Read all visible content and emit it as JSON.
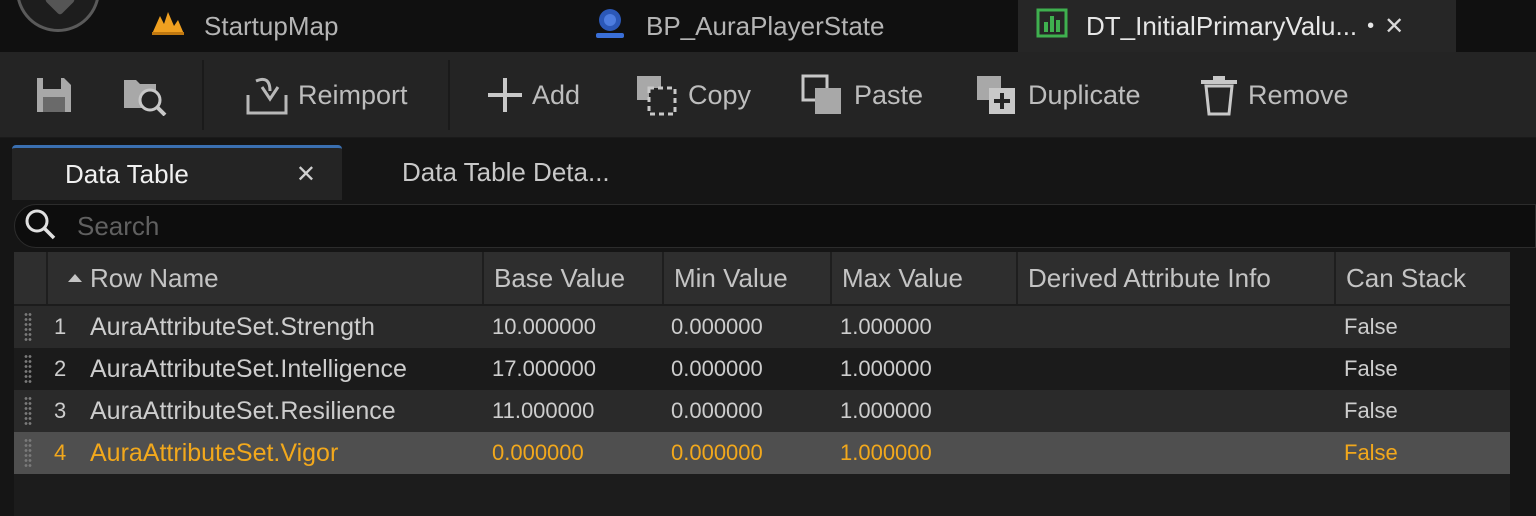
{
  "document_tabs": [
    {
      "label": "StartupMap",
      "icon": "level-map-icon",
      "icon_color": "#f0a020"
    },
    {
      "label": "BP_AuraPlayerState",
      "icon": "blueprint-icon",
      "icon_color": "#3a6fd8"
    },
    {
      "label": "DT_InitialPrimaryValu...",
      "icon": "data-table-icon",
      "icon_color": "#3fb04f",
      "active": true,
      "dirty_mark": "•",
      "close": "✕"
    }
  ],
  "toolbar": {
    "save_icon": "save-icon",
    "browse_icon": "browse-icon",
    "reimport": "Reimport",
    "add": "Add",
    "copy": "Copy",
    "paste": "Paste",
    "duplicate": "Duplicate",
    "remove": "Remove"
  },
  "panel_tabs": [
    {
      "label": "Data Table",
      "close": "✕",
      "active": true
    },
    {
      "label": "Data Table Deta..."
    }
  ],
  "search": {
    "placeholder": "Search",
    "value": ""
  },
  "table": {
    "columns": [
      "Row Name",
      "Base Value",
      "Min Value",
      "Max Value",
      "Derived Attribute Info",
      "Can Stack"
    ],
    "rows": [
      {
        "num": "1",
        "name": "AuraAttributeSet.Strength",
        "base": "10.000000",
        "min": "0.000000",
        "max": "1.000000",
        "derived": "",
        "stack": "False"
      },
      {
        "num": "2",
        "name": "AuraAttributeSet.Intelligence",
        "base": "17.000000",
        "min": "0.000000",
        "max": "1.000000",
        "derived": "",
        "stack": "False"
      },
      {
        "num": "3",
        "name": "AuraAttributeSet.Resilience",
        "base": "11.000000",
        "min": "0.000000",
        "max": "1.000000",
        "derived": "",
        "stack": "False"
      },
      {
        "num": "4",
        "name": "AuraAttributeSet.Vigor",
        "base": "0.000000",
        "min": "0.000000",
        "max": "1.000000",
        "derived": "",
        "stack": "False",
        "selected": true
      }
    ]
  },
  "colors": {
    "selected_text": "#f2a81c",
    "accent_tab": "#3a6fb0"
  }
}
